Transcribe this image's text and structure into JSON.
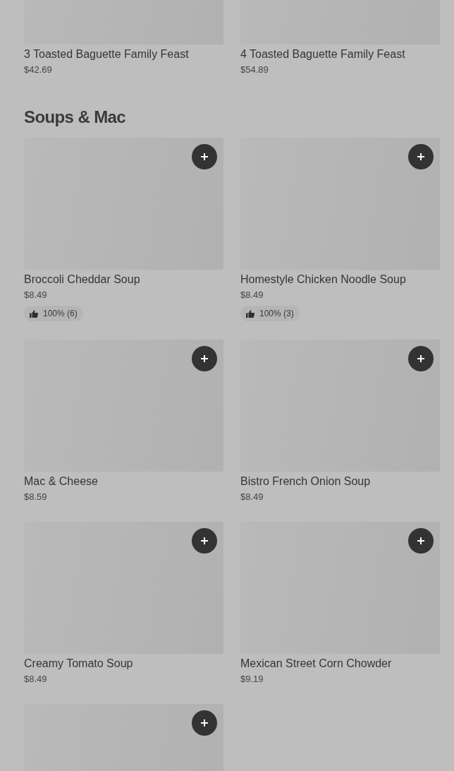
{
  "previous_items": [
    {
      "name": "3 Toasted Baguette Family Feast",
      "price": "$42.69"
    },
    {
      "name": "4 Toasted Baguette Family Feast",
      "price": "$54.89"
    }
  ],
  "section": {
    "title": "Soups & Mac",
    "items": [
      {
        "name": "Broccoli Cheddar Soup",
        "price": "$8.49",
        "rating": "100% (6)",
        "add_button": true
      },
      {
        "name": "Homestyle Chicken Noodle Soup",
        "price": "$8.49",
        "rating": "100% (3)",
        "add_button": true
      },
      {
        "name": "Mac & Cheese",
        "price": "$8.59",
        "add_button": true
      },
      {
        "name": "Bistro French Onion Soup",
        "price": "$8.49",
        "add_button": true
      },
      {
        "name": "Creamy Tomato Soup",
        "price": "$8.49",
        "add_button": true
      },
      {
        "name": "Mexican Street Corn Chowder",
        "price": "$9.19",
        "add_button": true
      },
      {
        "add_button": true
      }
    ]
  }
}
